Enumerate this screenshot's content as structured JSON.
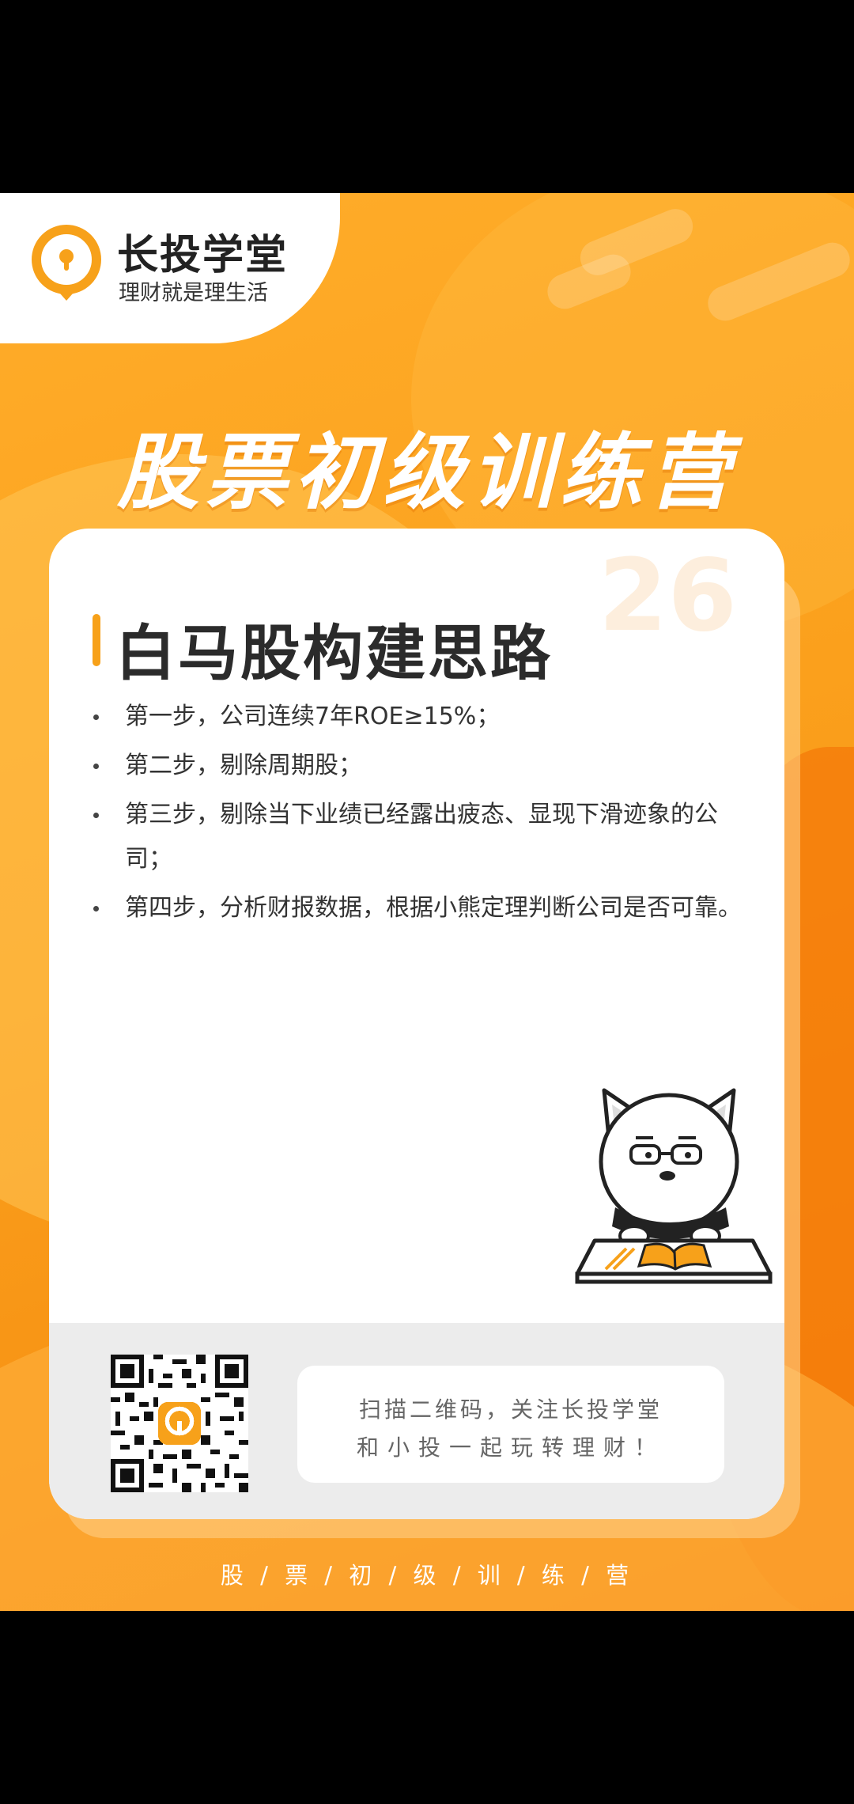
{
  "brand": {
    "name": "长投学堂",
    "slogan": "理财就是理生活"
  },
  "poster": {
    "main_title": "股票初级训练营",
    "number": "26",
    "card_title": "白马股构建思路",
    "steps": [
      "第一步，公司连续7年ROE≥15%；",
      "第二步，剔除周期股；",
      "第三步，剔除当下业绩已经露出疲态、显现下滑迹象的公司；",
      "第四步，分析财报数据，根据小熊定理判断公司是否可靠。"
    ],
    "cta_line1": "扫描二维码，关注长投学堂",
    "cta_line2": "和小投一起玩转理财！",
    "bottom_tag": "股 / 票 / 初 / 级 / 训 / 练 / 营"
  },
  "colors": {
    "accent": "#f7a11a",
    "background": "#fba01c",
    "card": "#ffffff",
    "footer": "#ececec"
  },
  "icons": {
    "logo": "lightbulb-logo-icon",
    "mascot": "bear-mascot-reading",
    "qr": "qr-code"
  }
}
